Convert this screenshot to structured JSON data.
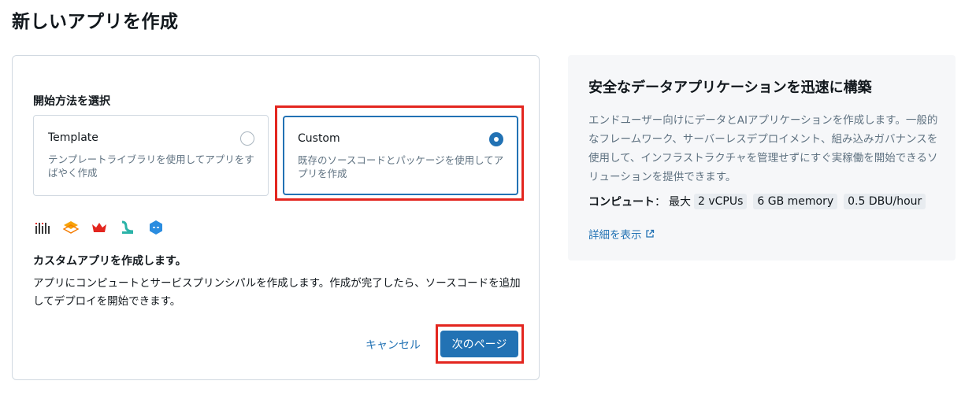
{
  "page": {
    "title": "新しいアプリを作成"
  },
  "form": {
    "section_label": "開始方法を選択",
    "options": [
      {
        "title": "Template",
        "description": "テンプレートライブラリを使用してアプリをすばやく作成",
        "selected": false
      },
      {
        "title": "Custom",
        "description": "既存のソースコードとパッケージを使用してアプリを作成",
        "selected": true
      }
    ],
    "logos": [
      "framework-bars-icon",
      "gradio-icon",
      "crown-icon",
      "streamlit-icon",
      "dash-icon"
    ],
    "custom_heading": "カスタムアプリを作成します。",
    "custom_description": "アプリにコンピュートとサービスプリンシパルを作成します。作成が完了したら、ソースコードを追加してデプロイを開始できます。",
    "cancel_label": "キャンセル",
    "next_label": "次のページ"
  },
  "info": {
    "title": "安全なデータアプリケーションを迅速に構築",
    "description": "エンドユーザー向けにデータとAIアプリケーションを作成します。一般的なフレームワーク、サーバーレスデプロイメント、組み込みガバナンスを使用して、インフラストラクチャを管理せずにすぐ実稼働を開始できるソリューションを提供できます。",
    "compute_label": "コンピュート",
    "compute_separator": "：",
    "compute_max": "最大",
    "chips": [
      "2 vCPUs",
      "6 GB memory",
      "0.5 DBU/hour"
    ],
    "learn_more": "詳細を表示"
  },
  "colors": {
    "accent": "#2272b4",
    "highlight": "#e3261f",
    "panel": "#f6f7f9"
  }
}
